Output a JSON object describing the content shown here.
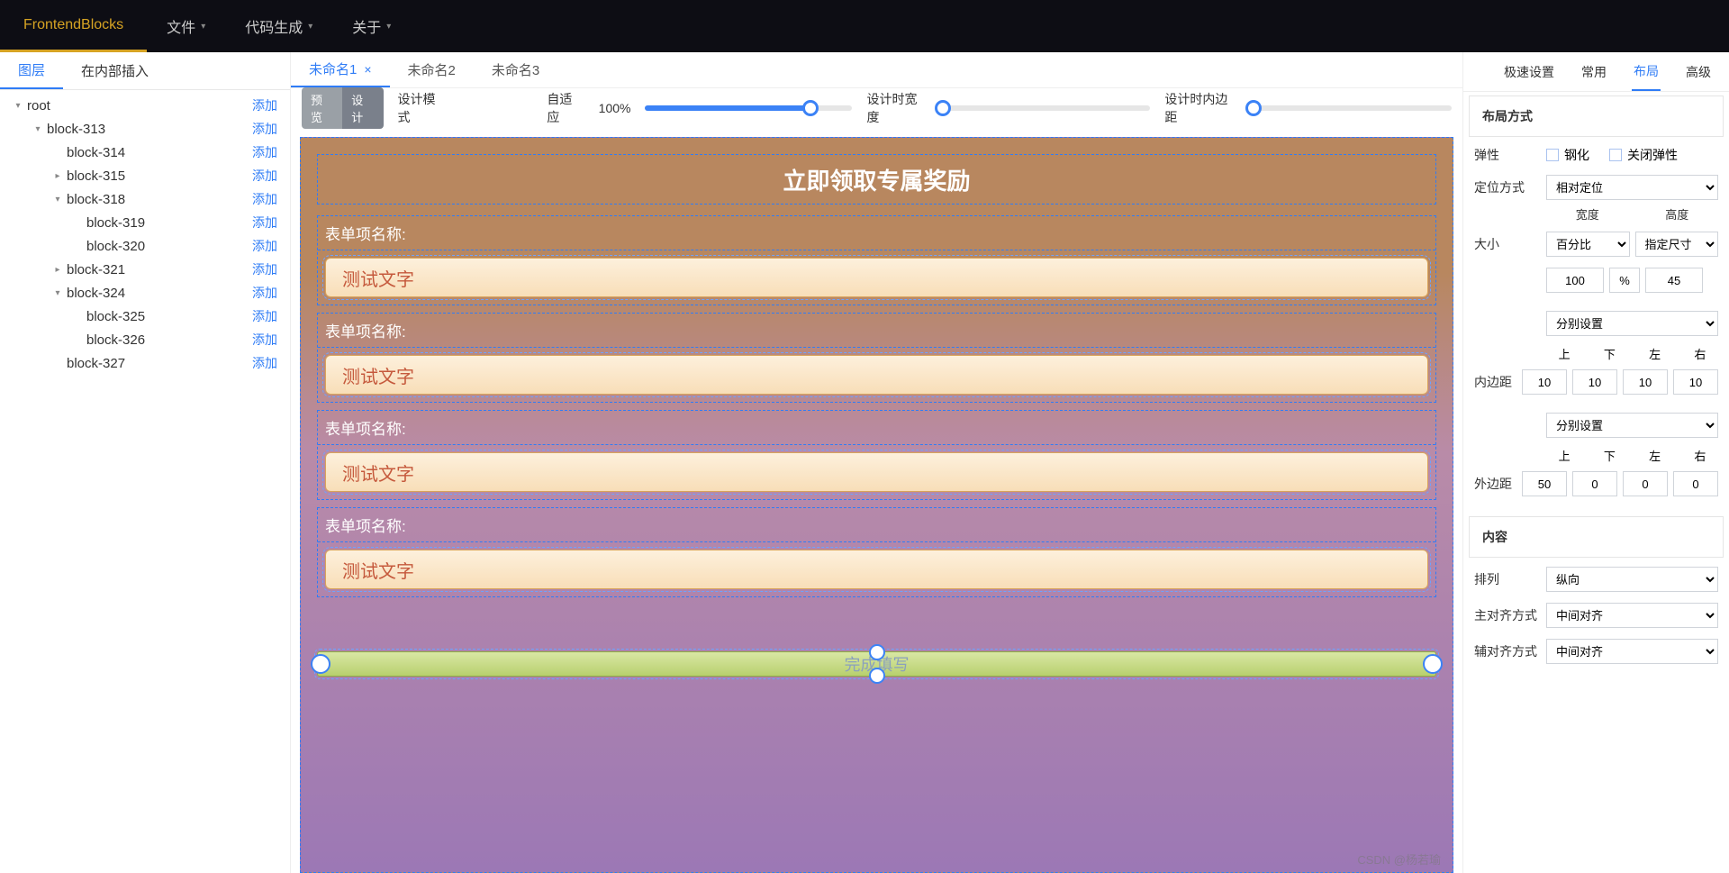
{
  "topbar": {
    "logo": "FrontendBlocks",
    "menus": [
      "文件",
      "代码生成",
      "关于"
    ]
  },
  "left": {
    "tabs": [
      "图层",
      "在内部插入"
    ],
    "active_tab": 0,
    "add_label": "添加",
    "tree": [
      {
        "name": "root",
        "indent": 0,
        "caret": "▾"
      },
      {
        "name": "block-313",
        "indent": 1,
        "caret": "▾"
      },
      {
        "name": "block-314",
        "indent": 2,
        "caret": ""
      },
      {
        "name": "block-315",
        "indent": 2,
        "caret": "▸"
      },
      {
        "name": "block-318",
        "indent": 2,
        "caret": "▾"
      },
      {
        "name": "block-319",
        "indent": 3,
        "caret": ""
      },
      {
        "name": "block-320",
        "indent": 3,
        "caret": ""
      },
      {
        "name": "block-321",
        "indent": 2,
        "caret": "▸"
      },
      {
        "name": "block-324",
        "indent": 2,
        "caret": "▾"
      },
      {
        "name": "block-325",
        "indent": 3,
        "caret": ""
      },
      {
        "name": "block-326",
        "indent": 3,
        "caret": ""
      },
      {
        "name": "block-327",
        "indent": 2,
        "caret": ""
      }
    ]
  },
  "center": {
    "file_tabs": [
      {
        "label": "未命名1",
        "active": true,
        "closable": true
      },
      {
        "label": "未命名2",
        "active": false,
        "closable": false
      },
      {
        "label": "未命名3",
        "active": false,
        "closable": false
      }
    ],
    "toolbar": {
      "seg": [
        "预览",
        "设计"
      ],
      "seg_label": "设计模式",
      "adapt_label": "自适应",
      "zoom_pct": "100%",
      "slider1": {
        "fill_pct": 80
      },
      "height_label": "设计时宽度",
      "slider2": {
        "fill_pct": 0
      },
      "padding_label": "设计时内边距",
      "slider3": {
        "fill_pct": 0
      }
    },
    "canvas": {
      "banner": "立即领取专属奖励",
      "form_label": "表单项名称:",
      "input_value": "测试文字",
      "submit": "完成填写",
      "watermark": "CSDN @杨若瑜"
    }
  },
  "right": {
    "tabs": [
      "极速设置",
      "常用",
      "布局",
      "高级"
    ],
    "active_tab": 2,
    "sections": {
      "layout_mode_h": "布局方式",
      "elastic_label": "弹性",
      "steel_label": "钢化",
      "close_elastic_label": "关闭弹性",
      "position_label": "定位方式",
      "position_value": "相对定位",
      "size_label": "大小",
      "width_h": "宽度",
      "height_h": "高度",
      "width_type": "百分比",
      "height_type": "指定尺寸",
      "width_val": "100",
      "width_unit": "%",
      "height_val": "45",
      "padding_h": "内边距",
      "split_set": "分别设置",
      "top_h": "上",
      "bottom_h": "下",
      "left_h": "左",
      "right_h": "右",
      "pad_t": "10",
      "pad_b": "10",
      "pad_l": "10",
      "pad_r": "10",
      "margin_h": "外边距",
      "mar_t": "50",
      "mar_b": "0",
      "mar_l": "0",
      "mar_r": "0",
      "content_h": "内容",
      "arrange_label": "排列",
      "arrange_value": "纵向",
      "main_align_label": "主对齐方式",
      "main_align_value": "中间对齐",
      "cross_align_label": "辅对齐方式",
      "cross_align_value": "中间对齐"
    }
  }
}
